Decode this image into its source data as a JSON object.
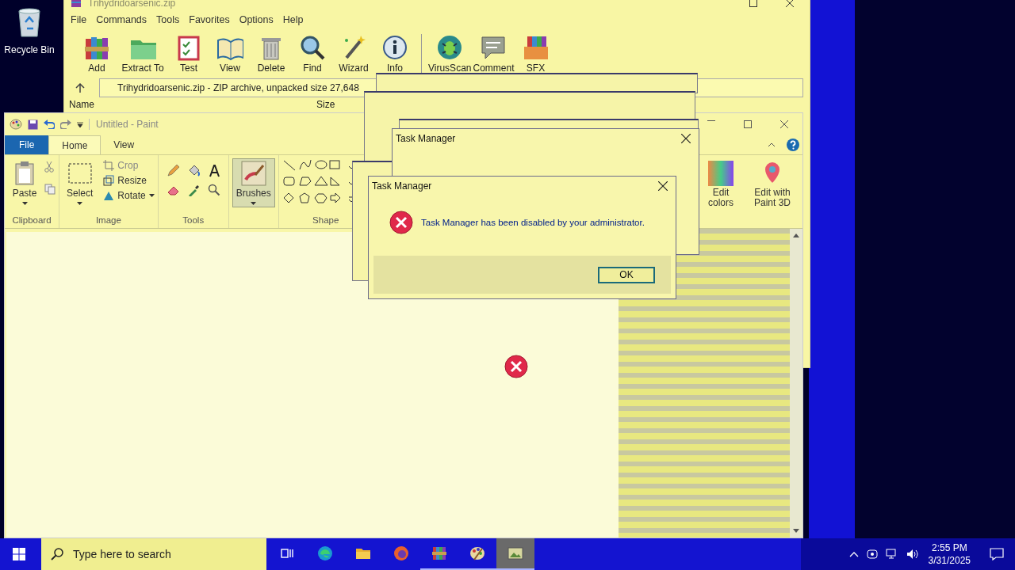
{
  "desktop": {
    "icons": [
      {
        "label": "Recycle Bin"
      }
    ]
  },
  "archiver_window": {
    "title": "Trihydridoarsenic.zip",
    "menu": [
      "File",
      "Commands",
      "Tools",
      "Favorites",
      "Options",
      "Help"
    ],
    "toolbar": [
      "Add",
      "Extract To",
      "Test",
      "View",
      "Delete",
      "Find",
      "Wizard",
      "Info",
      "VirusScan",
      "Comment",
      "SFX"
    ],
    "address": "Trihydridoarsenic.zip - ZIP archive, unpacked size 27,648",
    "columns": [
      "Name",
      "Size"
    ]
  },
  "paint_window": {
    "title": "Untitled - Paint",
    "tabs": [
      {
        "label": "File",
        "kind": "file",
        "selected": false
      },
      {
        "label": "Home",
        "kind": "tab",
        "selected": true
      },
      {
        "label": "View",
        "kind": "tab",
        "selected": false
      }
    ],
    "groups": [
      {
        "label": "Clipboard",
        "big": [
          "Paste"
        ]
      },
      {
        "label": "Image",
        "big": [
          "Select"
        ],
        "small": [
          "Crop",
          "Resize",
          "Rotate"
        ]
      },
      {
        "label": "Tools"
      },
      {
        "big": [
          "Brushes"
        ]
      },
      {
        "label": "Shape"
      },
      {
        "big": [
          "Edit colors",
          "Edit with Paint 3D"
        ]
      }
    ]
  },
  "background_dialog": {
    "title": "Task Manager"
  },
  "error_dialog": {
    "title": "Task Manager",
    "message": "Task Manager has been disabled by your administrator.",
    "button": "OK"
  },
  "taskbar": {
    "search_placeholder": "Type here to search",
    "apps": [
      {
        "running": false,
        "selected": false
      },
      {
        "running": false,
        "selected": false
      },
      {
        "running": false,
        "selected": false
      },
      {
        "running": false,
        "selected": false
      },
      {
        "running": true,
        "selected": false
      },
      {
        "running": true,
        "selected": false
      },
      {
        "running": true,
        "selected": true
      }
    ],
    "time": "2:55 PM",
    "date": "3/31/2025"
  }
}
